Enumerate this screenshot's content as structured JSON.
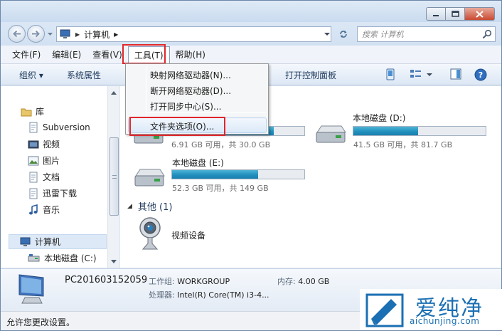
{
  "address": {
    "crumbs": [
      "计算机"
    ],
    "search_placeholder": "搜索 计算机"
  },
  "menubar": {
    "items": [
      {
        "label": "文件(F)"
      },
      {
        "label": "编辑(E)"
      },
      {
        "label": "查看(V)"
      },
      {
        "label": "工具(T)"
      },
      {
        "label": "帮助(H)"
      }
    ]
  },
  "toolbar": {
    "organize": "组织 ▾",
    "system_properties": "系统属性",
    "open_control_panel": "打开控制面板"
  },
  "tools_menu": {
    "items": [
      {
        "label": "映射网络驱动器(N)..."
      },
      {
        "label": "断开网络驱动器(D)..."
      },
      {
        "label": "打开同步中心(S)..."
      },
      {
        "label": "文件夹选项(O)..."
      }
    ],
    "highlighted_index": 3
  },
  "sidebar": {
    "items": [
      {
        "label": "库",
        "icon": "library-icon"
      },
      {
        "label": "Subversion",
        "icon": "document-library-icon"
      },
      {
        "label": "视频",
        "icon": "video-library-icon"
      },
      {
        "label": "图片",
        "icon": "picture-library-icon"
      },
      {
        "label": "文档",
        "icon": "document-library-icon"
      },
      {
        "label": "迅雷下载",
        "icon": "download-library-icon"
      },
      {
        "label": "音乐",
        "icon": "music-library-icon"
      },
      {
        "label": "计算机",
        "icon": "computer-icon"
      },
      {
        "label": "本地磁盘 (C:)",
        "icon": "drive-icon"
      }
    ]
  },
  "drives": [
    {
      "name": "",
      "free_text": "6.91 GB 可用，共 30.0 GB",
      "used_fraction": 0.77
    },
    {
      "name": "本地磁盘 (D:)",
      "free_text": "41.5 GB 可用，共 81.7 GB",
      "used_fraction": 0.49
    },
    {
      "name": "本地磁盘 (E:)",
      "free_text": "52.3 GB 可用，共 149 GB",
      "used_fraction": 0.65
    }
  ],
  "other_group": {
    "header": "其他 (1)",
    "items": [
      {
        "label": "视频设备"
      }
    ]
  },
  "details": {
    "computer_name": "PC201603152059",
    "workgroup_label": "工作组:",
    "workgroup_value": "WORKGROUP",
    "memory_label": "内存:",
    "memory_value": "4.00 GB",
    "cpu_label": "处理器:",
    "cpu_value": "Intel(R) Core(TM) i3-4..."
  },
  "status": {
    "text": "允许您更改设置。"
  },
  "watermark": {
    "brand": "爱纯净",
    "url": "aichunjing.com"
  },
  "colors": {
    "highlight_box": "#e0262c",
    "drive_fill": "#1f8dbb",
    "watermark": "#1b6fb3"
  }
}
